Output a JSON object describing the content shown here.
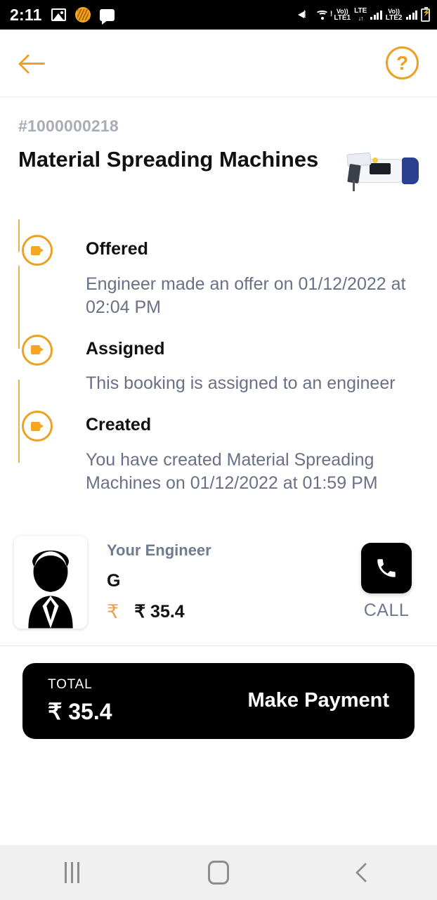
{
  "statusbar": {
    "time": "2:11",
    "left_icons": [
      "gallery-icon",
      "app-icon",
      "message-icon"
    ],
    "network": {
      "volte1": "Vo))",
      "sim1_label": "LTE1",
      "lte": "LTE",
      "volte2": "Vo))",
      "sim2_label": "LTE2"
    }
  },
  "appbar": {
    "back_label": "",
    "help_label": "?"
  },
  "order": {
    "id": "#1000000218",
    "title": "Material Spreading Machines"
  },
  "timeline": [
    {
      "status": "Offered",
      "description": "Engineer made an offer on 01/12/2022 at 02:04 PM"
    },
    {
      "status": "Assigned",
      "description": "This booking is assigned to an engineer"
    },
    {
      "status": "Created",
      "description": "You have created Material Spreading Machines on 01/12/2022 at 01:59 PM"
    }
  ],
  "engineer": {
    "label": "Your Engineer",
    "name": "G",
    "price": "₹ 35.4",
    "currency_icon": "₹",
    "call_label": "CALL"
  },
  "payment": {
    "total_label": "TOTAL",
    "total_amount": "₹ 35.4",
    "cta_label": "Make Payment"
  },
  "colors": {
    "accent": "#EDA122",
    "accent_fill": "#F5A623",
    "muted_text": "#697186",
    "dark": "#000000"
  }
}
